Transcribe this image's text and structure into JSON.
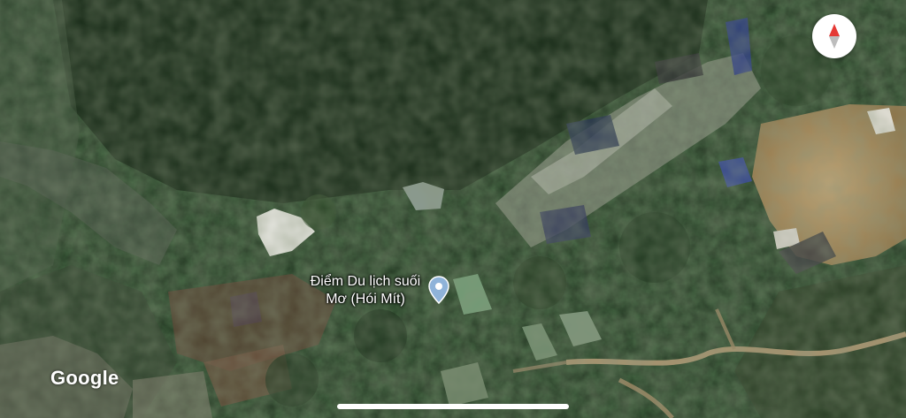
{
  "map": {
    "type": "satellite",
    "poi": {
      "label_line1": "Điểm Du lịch suối",
      "label_line2": "Mơ (Hói Mít)",
      "icon": "map-pin-icon"
    },
    "attribution": "Google",
    "controls": {
      "compass_icon": "compass-icon"
    }
  },
  "colors": {
    "forest_dark": "#142414",
    "forest_mid": "#213a22",
    "clearing": "#a88a5c",
    "road": "#b59a74",
    "roof_blue": "#2a3a8a",
    "pin_blue": "#8fb3d9",
    "compass_red": "#e53935"
  }
}
